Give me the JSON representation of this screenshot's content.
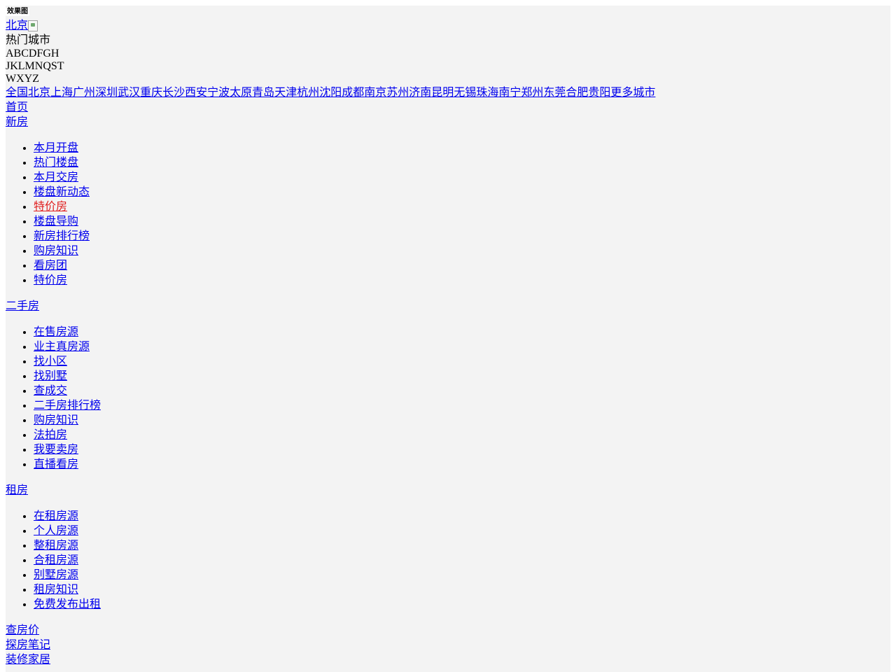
{
  "logo": {
    "alt_text": "效果图"
  },
  "current_city": {
    "label": "北京"
  },
  "hot_cities_title": "热门城市",
  "letter_rows": [
    "ABCDFGH",
    "JKLMNQST",
    "WXYZ"
  ],
  "cities": [
    "全国",
    "北京",
    "上海",
    "广州",
    "深圳",
    "武汉",
    "重庆",
    "长沙",
    "西安",
    "宁波",
    "太原",
    "青岛",
    "天津",
    "杭州",
    "沈阳",
    "成都",
    "南京",
    "苏州",
    "济南",
    "昆明",
    "无锡",
    "珠海",
    "南宁",
    "郑州",
    "东莞",
    "合肥",
    "贵阳",
    "更多城市"
  ],
  "nav": {
    "home": "首页",
    "new_house": {
      "label": "新房",
      "items": [
        "本月开盘",
        "热门楼盘",
        "本月交房",
        "楼盘新动态",
        "特价房",
        "楼盘导购",
        "新房排行榜",
        "购房知识",
        "看房团",
        "特价房"
      ],
      "highlight_color": "#e02020"
    },
    "second_hand": {
      "label": "二手房",
      "items": [
        "在售房源",
        "业主真房源",
        "找小区",
        "找别墅",
        "查成交",
        "二手房排行榜",
        "购房知识",
        "法拍房",
        "我要卖房",
        "直播看房"
      ]
    },
    "rent": {
      "label": "租房",
      "items": [
        "在租房源",
        "个人房源",
        "整租房源",
        "合租房源",
        "别墅房源",
        "租房知识",
        "免费发布出租"
      ]
    },
    "price_check": "查房价",
    "notes": "探房笔记",
    "decor": "装修家居"
  },
  "colors": {
    "page_bg": "#f3f3f3",
    "link": "#0000ee",
    "highlight": "#e02020"
  }
}
